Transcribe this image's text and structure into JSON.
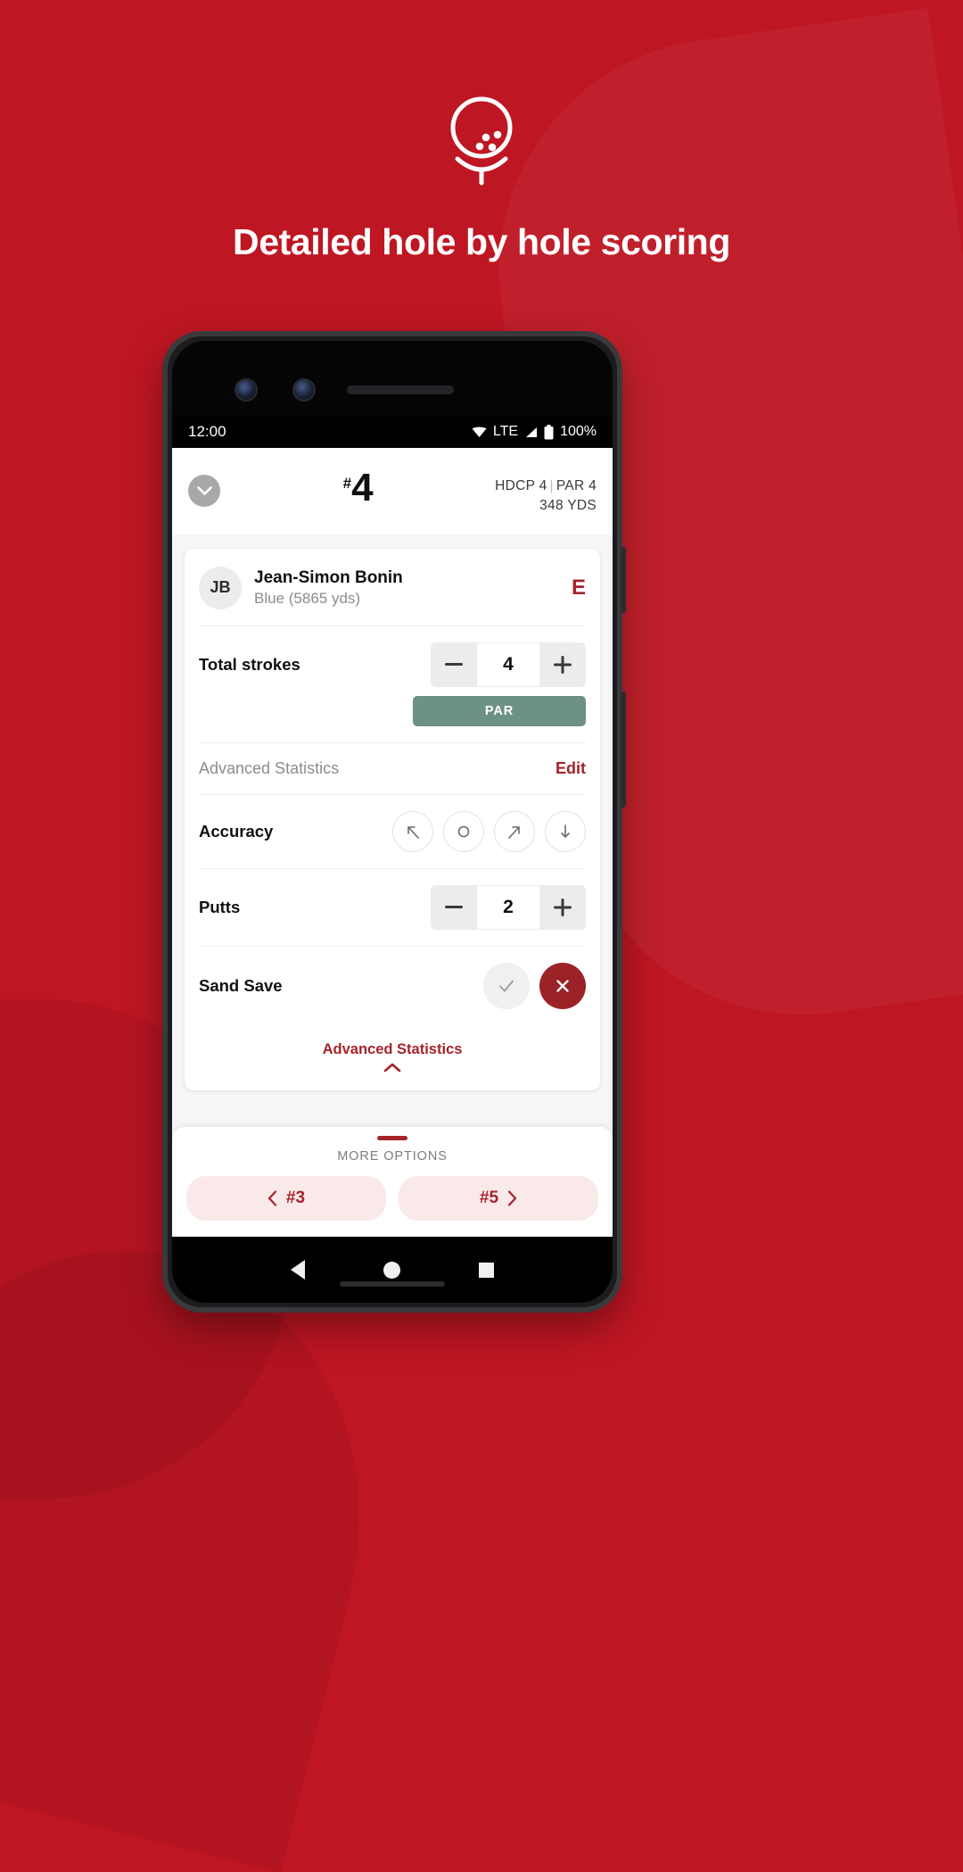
{
  "brand": {
    "accent": "#BE1622",
    "dark_red": "#A6232A",
    "par_green": "#6d9184"
  },
  "hero": {
    "icon": "golf-ball-on-tee-icon",
    "title": "Detailed hole by hole scoring"
  },
  "phone": {
    "status_bar": {
      "time": "12:00",
      "wifi_icon": "wifi-icon",
      "network": "LTE",
      "signal_icon": "signal-bars-icon",
      "battery_icon": "battery-full-icon",
      "battery_text": "100%"
    },
    "nav_bar": {
      "back_icon": "back-triangle-icon",
      "home_icon": "home-circle-icon",
      "recents_icon": "recents-square-icon"
    }
  },
  "app": {
    "header": {
      "collapse_icon": "chevron-down-icon",
      "hole_hash": "#",
      "hole_number": "4",
      "hdcp_label": "HDCP 4",
      "separator": "|",
      "par_label": "PAR 4",
      "yards_label": "348 YDS"
    },
    "player": {
      "initials": "JB",
      "name": "Jean-Simon Bonin",
      "tee": "Blue (5865 yds)",
      "score_to_par": "E"
    },
    "total_strokes": {
      "label": "Total strokes",
      "minus_icon": "minus-icon",
      "value": "4",
      "plus_icon": "plus-icon",
      "result_badge": "PAR"
    },
    "advanced_header": {
      "label": "Advanced Statistics",
      "edit_label": "Edit"
    },
    "accuracy": {
      "label": "Accuracy",
      "options": [
        {
          "icon": "arrow-up-left-icon",
          "selected": false
        },
        {
          "icon": "circle-icon",
          "selected": false
        },
        {
          "icon": "arrow-up-right-icon",
          "selected": false
        },
        {
          "icon": "arrow-down-icon",
          "selected": false
        }
      ]
    },
    "putts": {
      "label": "Putts",
      "minus_icon": "minus-icon",
      "value": "2",
      "plus_icon": "plus-icon"
    },
    "sand_save": {
      "label": "Sand Save",
      "yes_icon": "check-icon",
      "no_icon": "cross-icon",
      "selected": "no"
    },
    "advanced_toggle": {
      "label": "Advanced Statistics",
      "chevron_icon": "chevron-up-icon"
    },
    "bottom_sheet": {
      "grab_handle": "drag-handle",
      "title": "MORE OPTIONS",
      "prev_icon": "chevron-left-icon",
      "prev_label": "#3",
      "next_label": "#5",
      "next_icon": "chevron-right-icon"
    }
  }
}
